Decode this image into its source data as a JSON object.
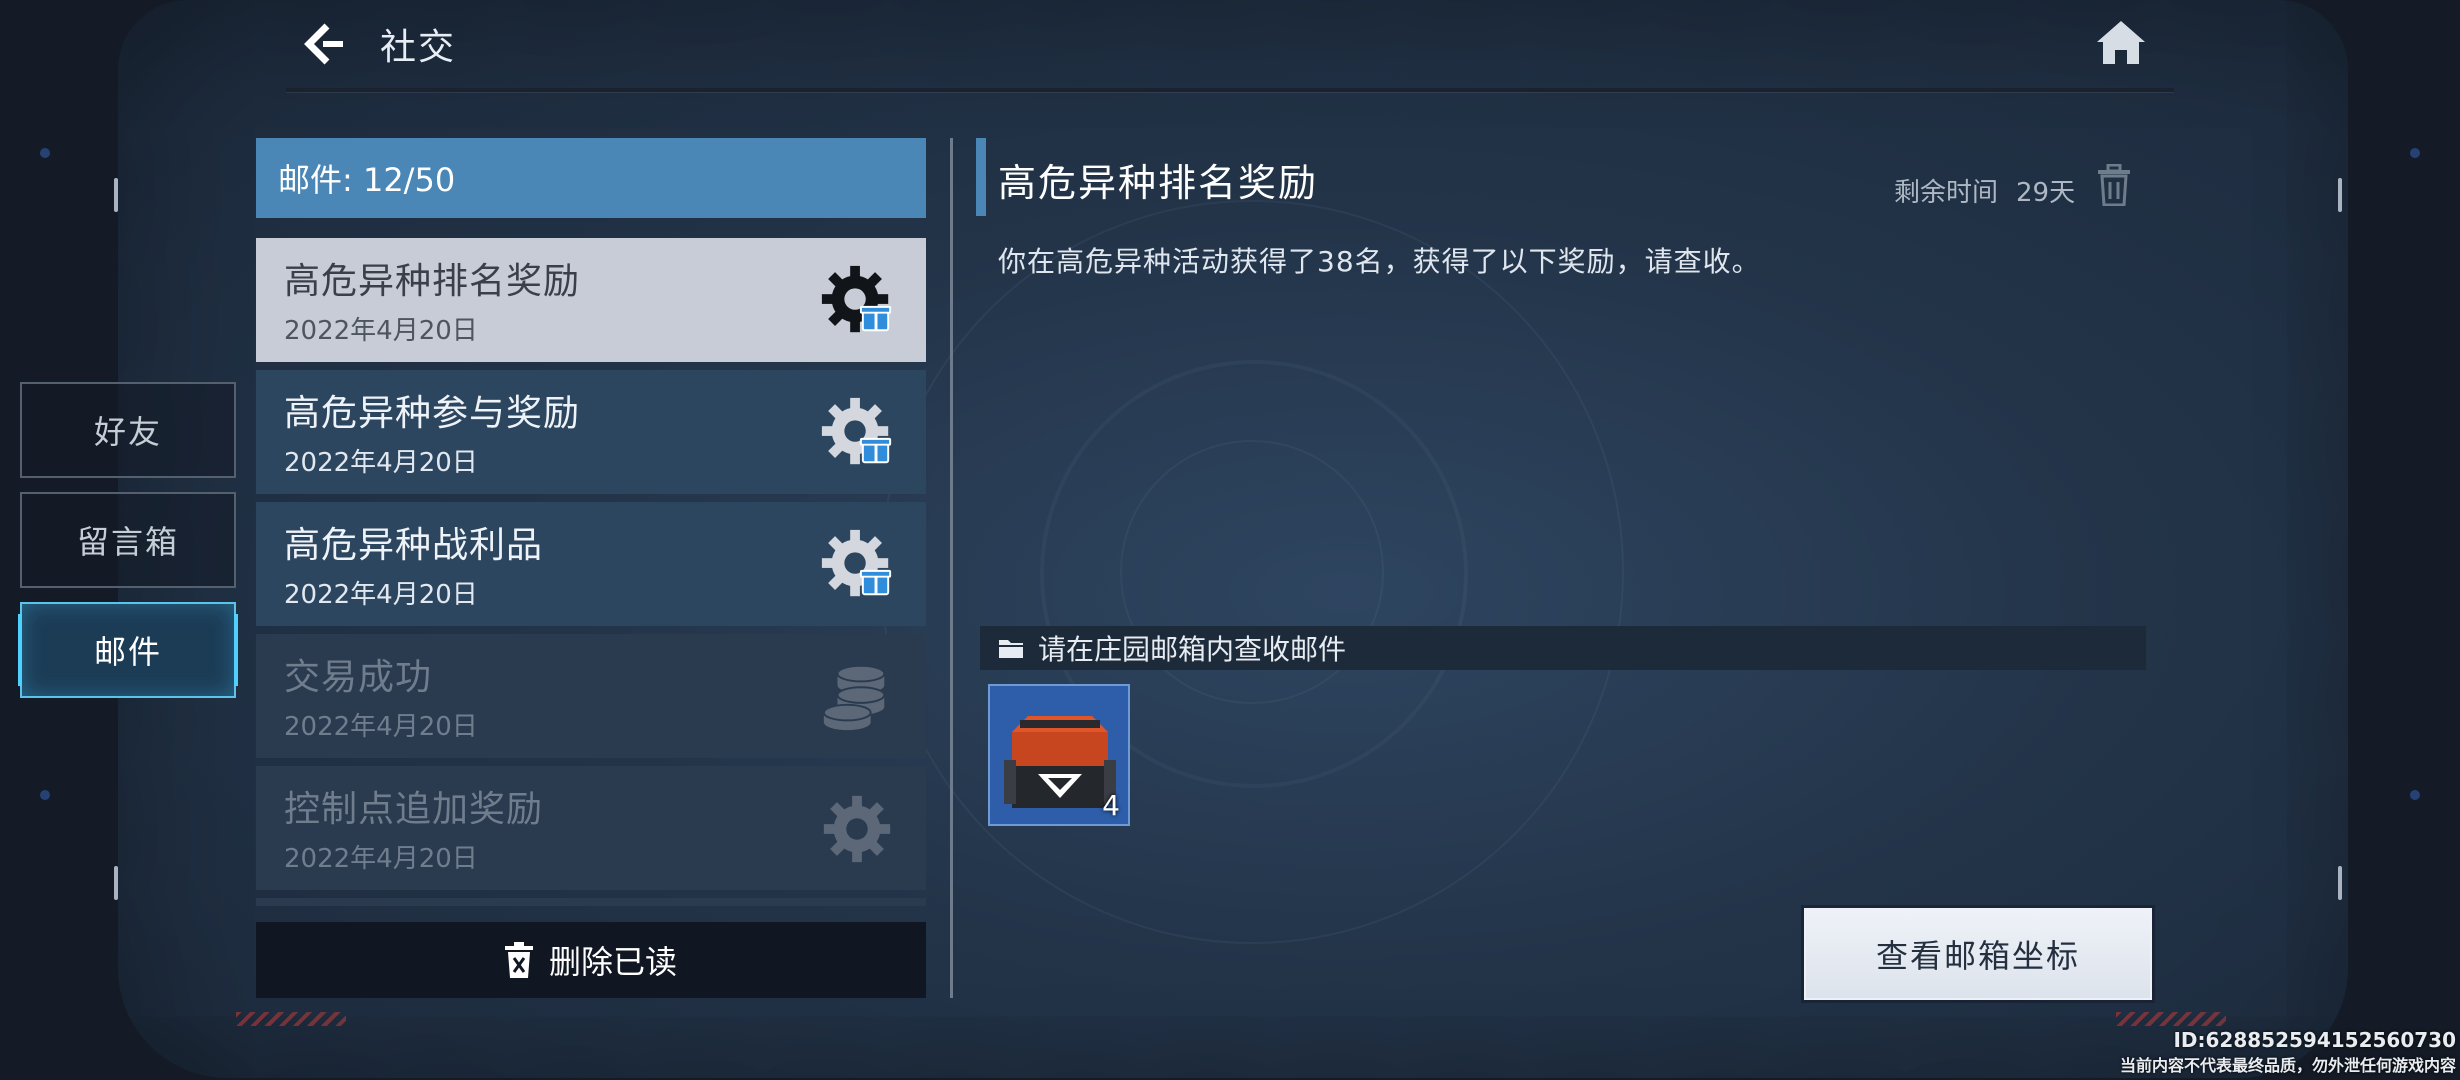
{
  "header": {
    "title": "社交"
  },
  "sidebar": {
    "tabs": [
      {
        "label": "好友",
        "active": false
      },
      {
        "label": "留言箱",
        "active": false
      },
      {
        "label": "邮件",
        "active": true
      }
    ]
  },
  "mailbox": {
    "counter_label": "邮件: 12/50",
    "items": [
      {
        "title": "高危异种排名奖励",
        "date": "2022年4月20日",
        "icon": "gear-gift-icon",
        "state": "selected"
      },
      {
        "title": "高危异种参与奖励",
        "date": "2022年4月20日",
        "icon": "gear-gift-icon",
        "state": "unread"
      },
      {
        "title": "高危异种战利品",
        "date": "2022年4月20日",
        "icon": "gear-gift-icon",
        "state": "unread"
      },
      {
        "title": "交易成功",
        "date": "2022年4月20日",
        "icon": "coins-icon",
        "state": "read"
      },
      {
        "title": "控制点追加奖励",
        "date": "2022年4月20日",
        "icon": "gear-icon",
        "state": "read"
      }
    ],
    "delete_read_label": "删除已读"
  },
  "detail": {
    "title": "高危异种排名奖励",
    "remaining_label": "剩余时间",
    "remaining_value": "29天",
    "body": "你在高危异种活动获得了38名，获得了以下奖励，请查收。",
    "attachment_notice": "请在庄园邮箱内查收邮件",
    "attachments": [
      {
        "icon": "supply-crate-icon",
        "quantity": "4"
      }
    ],
    "view_coords_label": "查看邮箱坐标"
  },
  "watermark": {
    "id": "ID:628852594152560730",
    "note": "当前内容不代表最终品质，勿外泄任何游戏内容"
  },
  "colors": {
    "accent_blue": "#4a86b6",
    "active_tab_border": "#5cc3ea",
    "selected_item_bg": "#c8ccd6",
    "gift_badge": "#2f8ddc"
  }
}
